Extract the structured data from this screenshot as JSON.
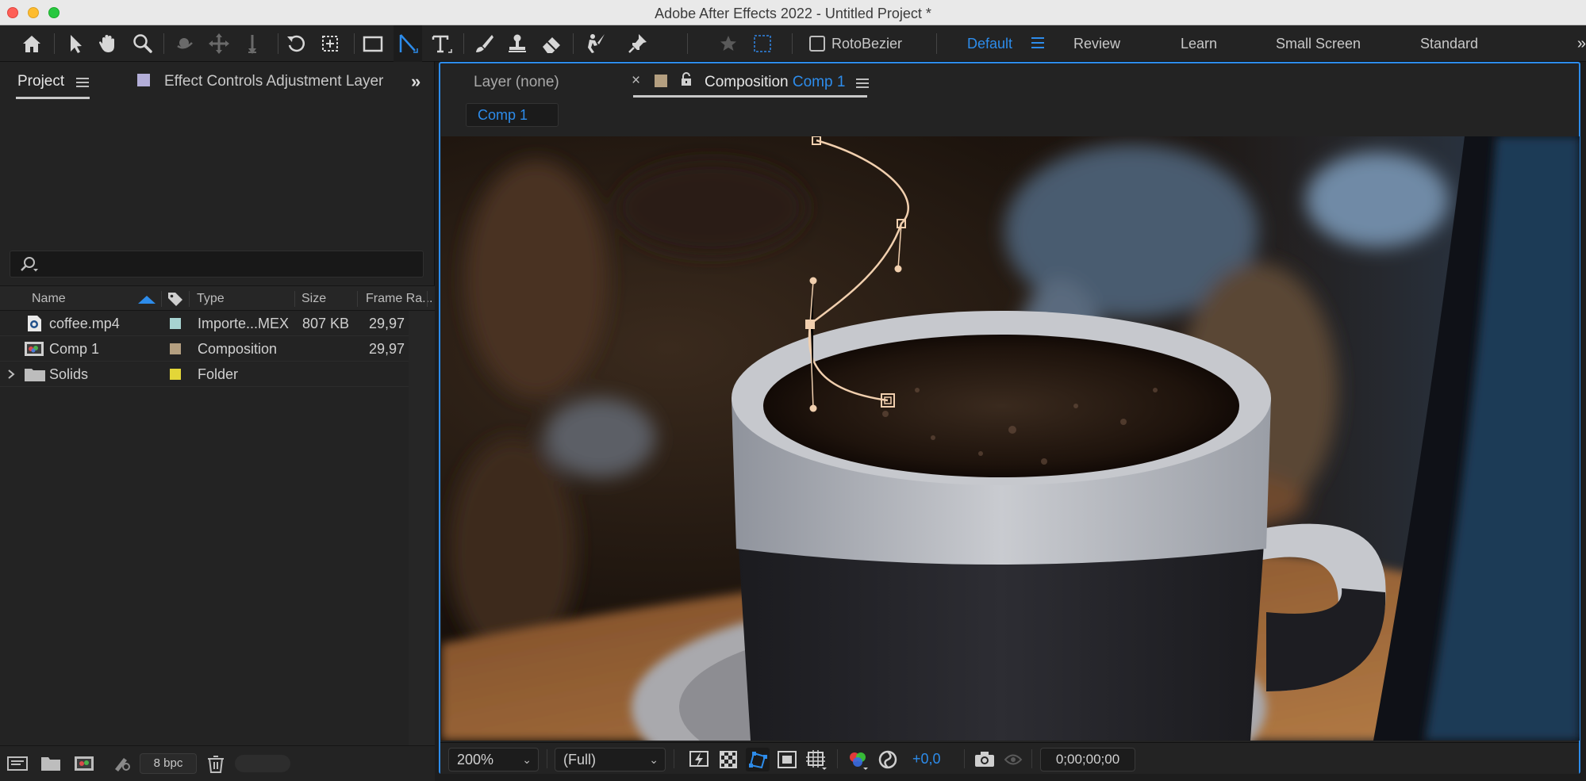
{
  "window": {
    "title": "Adobe After Effects 2022 - Untitled Project *"
  },
  "toolbar": {
    "tools": [
      "home-icon",
      "selection-icon",
      "hand-icon",
      "zoom-icon",
      "orbit-camera-icon",
      "pan-camera-icon",
      "dolly-camera-icon",
      "rotation-icon",
      "pan-behind-icon",
      "rectangle-icon",
      "pen-icon",
      "type-icon",
      "brush-icon",
      "clone-stamp-icon",
      "eraser-icon",
      "roto-brush-icon",
      "puppet-pin-icon",
      "star-icon",
      "snapping-icon"
    ],
    "rotobezier_label": "RotoBezier",
    "workspaces": [
      "Default",
      "Review",
      "Learn",
      "Small Screen",
      "Standard"
    ],
    "active_workspace": "Default",
    "overflow": "»"
  },
  "project_panel": {
    "tab_project": "Project",
    "tab_effect_controls": "Effect Controls Adjustment Layer",
    "columns": {
      "name": "Name",
      "type": "Type",
      "size": "Size",
      "frame_rate": "Frame Ra..."
    },
    "items": [
      {
        "name": "coffee.mp4",
        "type": "Importe...MEX",
        "size": "807 KB",
        "frame_rate": "29,97",
        "label_color": "#a7d3d1"
      },
      {
        "name": "Comp 1",
        "type": "Composition",
        "size": "",
        "frame_rate": "29,97",
        "label_color": "#b49f80"
      },
      {
        "name": "Solids",
        "type": "Folder",
        "size": "",
        "frame_rate": "",
        "label_color": "#e3d638"
      }
    ],
    "bpc_label": "8 bpc"
  },
  "comp_panel": {
    "tab_layer": "Layer (none)",
    "tab_close": "×",
    "tab_comp_prefix": "Composition",
    "tab_comp_name": "Comp 1",
    "breadcrumb": "Comp 1",
    "zoom": "200%",
    "resolution": "(Full)",
    "exposure": "+0,0",
    "timecode": "0;00;00;00"
  },
  "colors": {
    "accent": "#2d8ceb",
    "path": "#f1cfae"
  }
}
